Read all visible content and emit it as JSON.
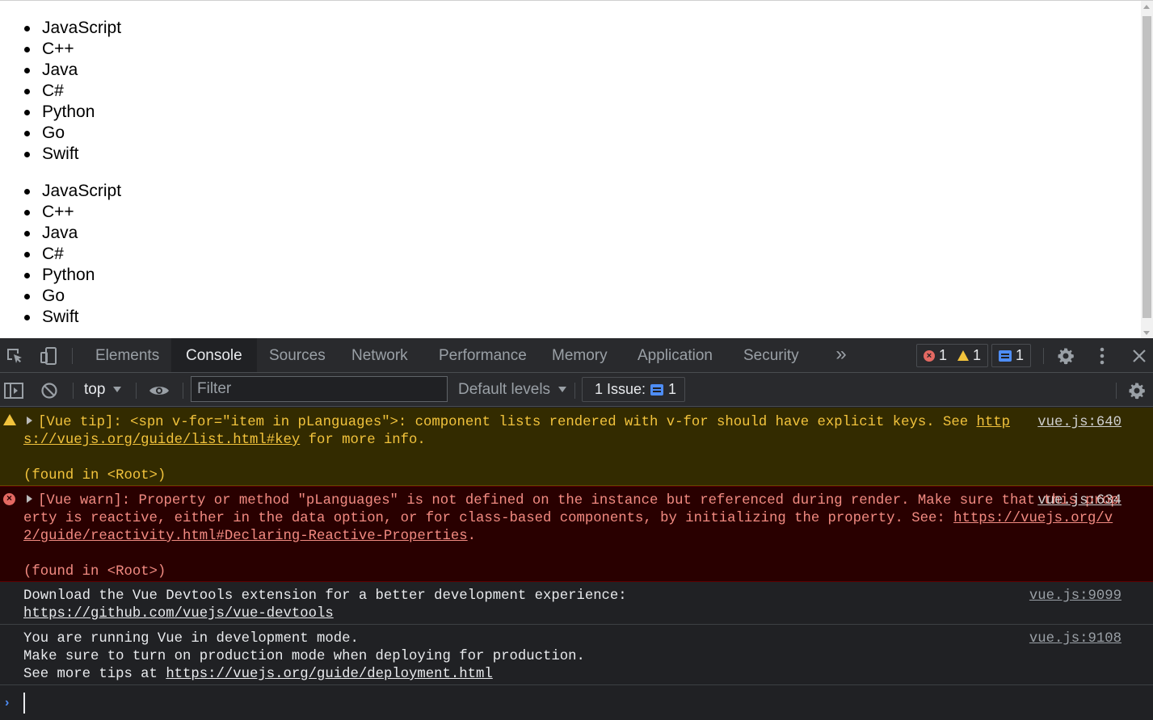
{
  "page": {
    "list_1": [
      "JavaScript",
      "C++",
      "Java",
      "C#",
      "Python",
      "Go",
      "Swift"
    ],
    "list_2": [
      "JavaScript",
      "C++",
      "Java",
      "C#",
      "Python",
      "Go",
      "Swift"
    ]
  },
  "devtools": {
    "tabs": [
      "Elements",
      "Console",
      "Sources",
      "Network",
      "Performance",
      "Memory",
      "Application",
      "Security"
    ],
    "active_tab": "Console",
    "more_tabs_glyph": "»",
    "counters": {
      "errors": "1",
      "warnings": "1",
      "messages": "1"
    },
    "toolbar": {
      "context": "top",
      "filter_placeholder": "Filter",
      "levels": "Default levels",
      "issues_label": "1 Issue:",
      "issues_count": "1"
    },
    "messages": [
      {
        "level": "warning",
        "text_before_link": "[Vue tip]: <spn v-for=\"item in pLanguages\">: component lists rendered with v-for should have explicit keys. See ",
        "link": "https://vuejs.org/guide/list.html#key",
        "text_after_link": " for more info.",
        "found_in": "(found in <Root>)",
        "source": "vue.js:640"
      },
      {
        "level": "error",
        "text_before_link": "[Vue warn]: Property or method \"pLanguages\" is not defined on the instance but referenced during render. Make sure that this property is reactive, either in the data option, or for class-based components, by initializing the property. See: ",
        "link": "https://vuejs.org/v2/guide/reactivity.html#Declaring-Reactive-Properties",
        "text_after_link": ".",
        "found_in": "(found in <Root>)",
        "source": "vue.js:634"
      },
      {
        "level": "info",
        "line_1": "Download the Vue Devtools extension for a better development experience:",
        "link": "https://github.com/vuejs/vue-devtools",
        "source": "vue.js:9099"
      },
      {
        "level": "info",
        "line_1": "You are running Vue in development mode.",
        "line_2": "Make sure to turn on production mode when deploying for production.",
        "line_3_prefix": "See more tips at ",
        "link": "https://vuejs.org/guide/deployment.html",
        "source": "vue.js:9108"
      }
    ],
    "prompt_glyph": "›"
  },
  "colors": {
    "devtools_bg": "#202124",
    "warning_bg": "#332b00",
    "warning_text": "#f2c33c",
    "error_bg": "#290000",
    "error_text": "#f28b82",
    "accent_blue": "#4e8df5"
  }
}
